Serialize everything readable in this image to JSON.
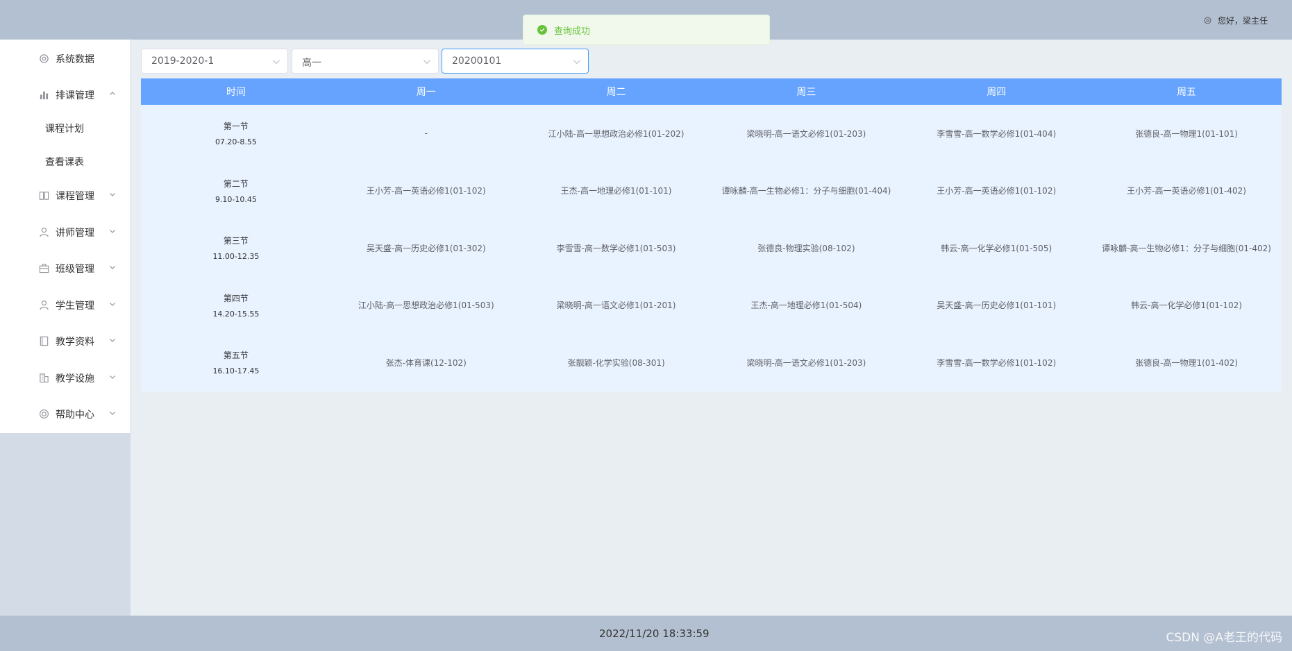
{
  "header": {
    "greeting": "您好，梁主任"
  },
  "toast": {
    "message": "查询成功"
  },
  "menu": {
    "system_data": "系统数据",
    "scheduling": "排课管理",
    "course_plan": "课程计划",
    "view_timetable": "查看课表",
    "course_mgmt": "课程管理",
    "teacher_mgmt": "讲师管理",
    "class_mgmt": "班级管理",
    "student_mgmt": "学生管理",
    "teaching_materials": "教学资料",
    "teaching_facilities": "教学设施",
    "help_center": "帮助中心"
  },
  "filters": {
    "semester": "2019-2020-1",
    "grade": "高一",
    "class": "20200101"
  },
  "table": {
    "headers": [
      "时间",
      "周一",
      "周二",
      "周三",
      "周四",
      "周五"
    ],
    "rows": [
      {
        "slot": "第一节",
        "range": "07.20-8.55",
        "cells": [
          "-",
          "江小陆-高一思想政治必修1(01-202)",
          "梁晓明-高一语文必修1(01-203)",
          "李雪雪-高一数学必修1(01-404)",
          "张德良-高一物理1(01-101)"
        ]
      },
      {
        "slot": "第二节",
        "range": "9.10-10.45",
        "cells": [
          "王小芳-高一英语必修1(01-102)",
          "王杰-高一地理必修1(01-101)",
          "谭咏麟-高一生物必修1：分子与细胞(01-404)",
          "王小芳-高一英语必修1(01-102)",
          "王小芳-高一英语必修1(01-402)"
        ]
      },
      {
        "slot": "第三节",
        "range": "11.00-12.35",
        "cells": [
          "吴天盛-高一历史必修1(01-302)",
          "李雪雪-高一数学必修1(01-503)",
          "张德良-物理实验(08-102)",
          "韩云-高一化学必修1(01-505)",
          "谭咏麟-高一生物必修1：分子与细胞(01-402)"
        ]
      },
      {
        "slot": "第四节",
        "range": "14.20-15.55",
        "cells": [
          "江小陆-高一思想政治必修1(01-503)",
          "梁晓明-高一语文必修1(01-201)",
          "王杰-高一地理必修1(01-504)",
          "吴天盛-高一历史必修1(01-101)",
          "韩云-高一化学必修1(01-102)"
        ]
      },
      {
        "slot": "第五节",
        "range": "16.10-17.45",
        "cells": [
          "张杰-体育课(12-102)",
          "张靓颖-化学实验(08-301)",
          "梁晓明-高一语文必修1(01-203)",
          "李雪雪-高一数学必修1(01-102)",
          "张德良-高一物理1(01-402)"
        ]
      }
    ]
  },
  "footer": {
    "timestamp": "2022/11/20 18:33:59",
    "watermark": "CSDN @A老王的代码"
  }
}
